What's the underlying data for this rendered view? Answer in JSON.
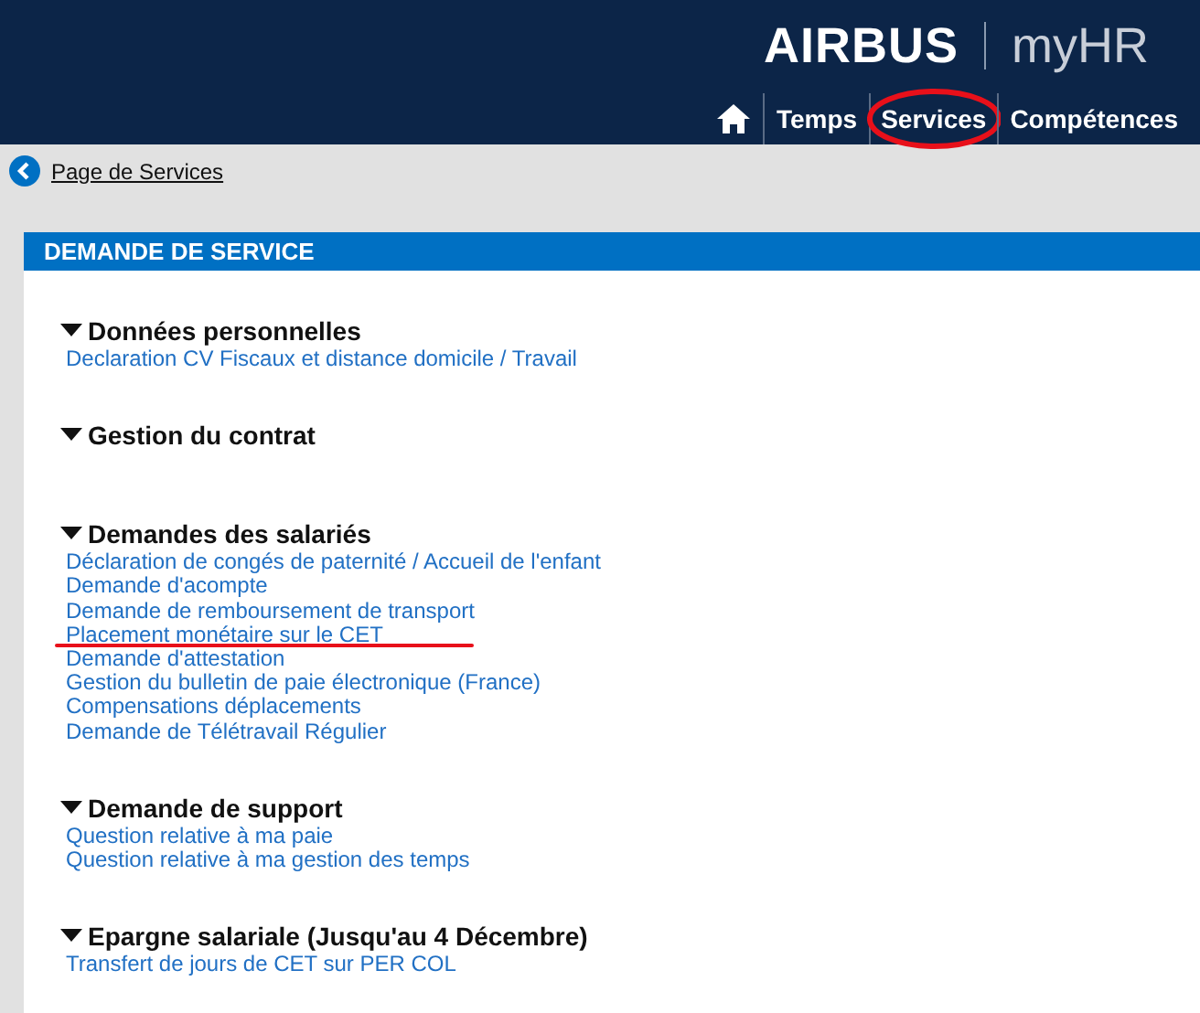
{
  "header": {
    "logo": "AIRBUS",
    "app_name": "myHR"
  },
  "nav": [
    {
      "label": "Temps",
      "circled": false
    },
    {
      "label": "Services",
      "circled": true
    },
    {
      "label": "Compétences",
      "circled": false
    }
  ],
  "breadcrumb": {
    "label": "Page de Services"
  },
  "panel": {
    "title": "DEMANDE DE SERVICE",
    "sections": [
      {
        "title": "Données personnelles",
        "expanded": true,
        "links": [
          {
            "label": "Declaration CV Fiscaux et distance domicile / Travail",
            "underlined": false
          }
        ]
      },
      {
        "title": "Gestion du contrat",
        "expanded": true
      },
      {
        "title": "Demandes des salariés",
        "expanded": true,
        "links": [
          {
            "label": "Déclaration de congés de paternité / Accueil de l'enfant",
            "underlined": false
          },
          {
            "label": "Demande d'acompte",
            "underlined": false
          },
          {
            "label": "Demande de remboursement de transport",
            "underlined": false
          },
          {
            "label": "Placement monétaire sur le CET",
            "underlined": true
          },
          {
            "label": "Demande d'attestation",
            "underlined": false
          },
          {
            "label": "Gestion du bulletin de paie électronique (France)",
            "underlined": false
          },
          {
            "label": "Compensations déplacements",
            "underlined": false
          },
          {
            "label": "Demande de Télétravail Régulier",
            "underlined": false
          }
        ]
      },
      {
        "title": "Demande de support",
        "expanded": true,
        "links": [
          {
            "label": "Question relative à ma paie",
            "underlined": false
          },
          {
            "label": "Question relative à ma gestion des temps",
            "underlined": false
          }
        ]
      },
      {
        "title": "Epargne salariale (Jusqu'au 4 Décembre)",
        "expanded": true,
        "links": [
          {
            "label": "Transfert de jours de CET sur PER COL",
            "underlined": false
          }
        ]
      }
    ]
  }
}
